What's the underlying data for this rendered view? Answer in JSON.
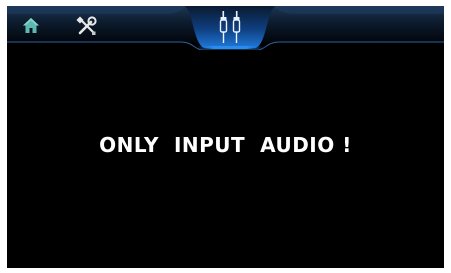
{
  "topbar": {
    "home_icon": "home-icon",
    "settings_icon": "tools-icon",
    "source_icon": "rca-audio-cable-icon",
    "active_color": "#1e8fe0",
    "home_color": "#5fb8b0"
  },
  "main": {
    "message": "ONLY  INPUT  AUDIO !"
  }
}
